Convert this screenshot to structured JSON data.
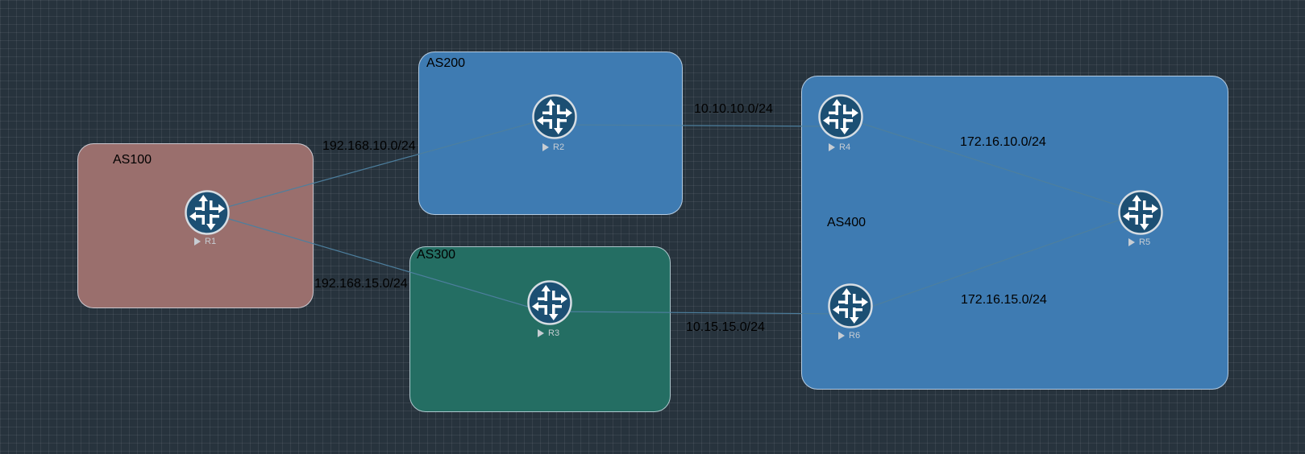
{
  "autonomous_systems": [
    {
      "id": "as100",
      "label": "AS100",
      "color": "#9a6f6d"
    },
    {
      "id": "as200",
      "label": "AS200",
      "color": "#3e7bb2"
    },
    {
      "id": "as300",
      "label": "AS300",
      "color": "#246e63"
    },
    {
      "id": "as400",
      "label": "AS400",
      "color": "#3e7bb2"
    }
  ],
  "routers": [
    {
      "id": "r1",
      "name": "R1",
      "icon": "router-icon"
    },
    {
      "id": "r2",
      "name": "R2",
      "icon": "router-icon"
    },
    {
      "id": "r3",
      "name": "R3",
      "icon": "router-icon"
    },
    {
      "id": "r4",
      "name": "R4",
      "icon": "router-icon"
    },
    {
      "id": "r5",
      "name": "R5",
      "icon": "router-icon"
    },
    {
      "id": "r6",
      "name": "R6",
      "icon": "router-icon"
    }
  ],
  "links": [
    {
      "from": "R1",
      "to": "R2",
      "subnet": "192.168.10.0/24"
    },
    {
      "from": "R1",
      "to": "R3",
      "subnet": "192.168.15.0/24"
    },
    {
      "from": "R2",
      "to": "R4",
      "subnet": "10.10.10.0/24"
    },
    {
      "from": "R3",
      "to": "R6",
      "subnet": "10.15.15.0/24"
    },
    {
      "from": "R4",
      "to": "R5",
      "subnet": "172.16.10.0/24"
    },
    {
      "from": "R6",
      "to": "R5",
      "subnet": "172.16.15.0/24"
    }
  ],
  "colors": {
    "background": "#27333d",
    "link_line": "#4d7f9e",
    "router_fill": "#1c4f73",
    "router_ring": "#d6dde3"
  }
}
